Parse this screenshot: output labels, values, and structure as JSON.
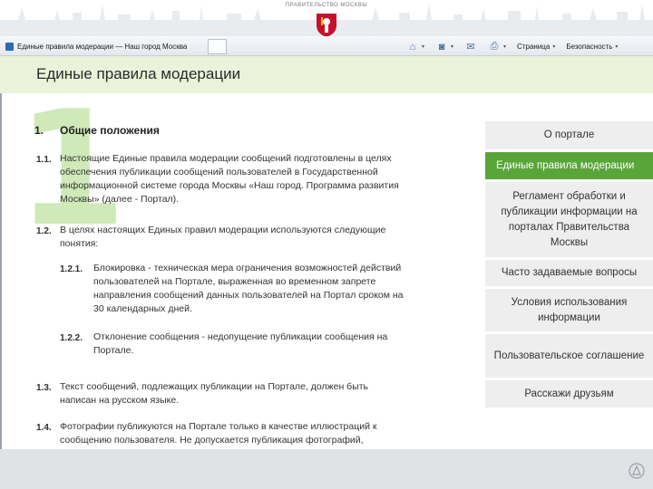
{
  "banner": {
    "title": "правительство москвы",
    "emblem_icon": "moscow-crest-icon"
  },
  "browser": {
    "tab_title": "Единые правила модерации — Наш город Москва",
    "toolbar": {
      "home_icon": "home-icon",
      "feeds_icon": "rss-icon",
      "mail_icon": "mail-icon",
      "print_icon": "print-icon",
      "page_label": "Страница",
      "safety_label": "Безопасность",
      "caret": "▾"
    }
  },
  "page": {
    "title": "Единые правила модерации",
    "watermark": "1"
  },
  "article": {
    "section_number": "1.",
    "section_title": "Общие положения",
    "p1_1": {
      "num": "1.1.",
      "lines": [
        "Настоящие Единые правила модерации сообщений подготовлены в целях",
        "обеспечения публикации сообщений пользователей в Государственной",
        "информационной системе города Москвы «Наш город. Программа развития",
        "Москвы» (далее - Портал)."
      ]
    },
    "p1_2": {
      "num": "1.2.",
      "lines": [
        "В целях настоящих Единых правил модерации используются следующие",
        "понятия:"
      ]
    },
    "p1_2_1": {
      "num": "1.2.1.",
      "lines": [
        "Блокировка - техническая мера ограничения возможностей действий",
        "пользователей на Портале, выраженная во временном запрете",
        "направления сообщений данных пользователей на Портал сроком на",
        "30 календарных дней."
      ]
    },
    "p1_2_2": {
      "num": "1.2.2.",
      "lines": [
        "Отклонение сообщения - недопущение публикации сообщения на",
        "Портале."
      ]
    },
    "p1_3": {
      "num": "1.3.",
      "lines": [
        "Текст сообщений, подлежащих публикации на Портале, должен быть",
        "написан на русском языке."
      ]
    },
    "p1_4": {
      "num": "1.4.",
      "lines": [
        "Фотографии публикуются на Портале только в качестве иллюстраций к",
        "сообщению пользователя. Не допускается публикация фотографий,"
      ]
    }
  },
  "sidebar": {
    "items": [
      {
        "label": "О портале"
      },
      {
        "label": "Единые правила модерации"
      },
      {
        "label": "Регламент обработки и публикации информации на порталах Правительства Москвы"
      },
      {
        "label": "Часто задаваемые вопросы"
      },
      {
        "label": "Условия использования информации"
      },
      {
        "label": "Пользовательское соглашение"
      },
      {
        "label": "Расскажи друзьям"
      }
    ]
  },
  "colors": {
    "accent_green": "#5aa53a",
    "header_band": "#eaf2d9",
    "watermark": "#cfe9b8",
    "sidebar_bg": "#eeeeee"
  }
}
